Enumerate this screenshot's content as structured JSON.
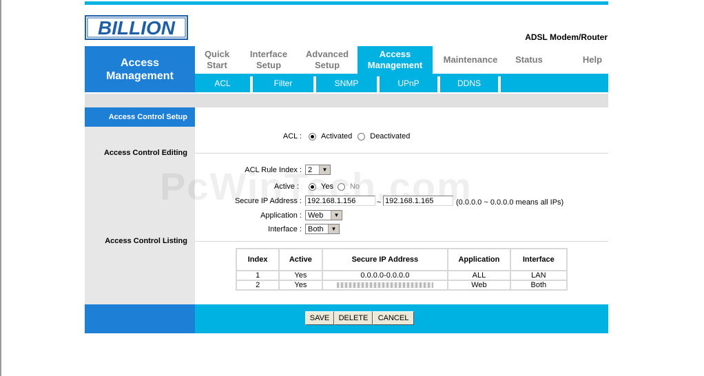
{
  "brand": {
    "logo": "BILLION",
    "product": "ADSL Modem/Router",
    "accent": "#00b2e2",
    "sidebar_color": "#1e7fd6"
  },
  "page_title": "Access Management",
  "main_nav": [
    {
      "label": "Quick Start"
    },
    {
      "label": "Interface Setup"
    },
    {
      "label": "Advanced Setup"
    },
    {
      "label": "Access Management",
      "active": true
    },
    {
      "label": "Maintenance"
    },
    {
      "label": "Status"
    },
    {
      "label": "Help"
    }
  ],
  "sub_nav": [
    {
      "label": "ACL"
    },
    {
      "label": "Filter"
    },
    {
      "label": "SNMP"
    },
    {
      "label": "UPnP"
    },
    {
      "label": "DDNS"
    }
  ],
  "side": {
    "active": "Access Control Setup",
    "editing": "Access Control Editing",
    "listing": "Access Control Listing"
  },
  "form": {
    "acl_label": "ACL :",
    "acl_options": [
      "Activated",
      "Deactivated"
    ],
    "acl_selected": "Activated",
    "rule_index_label": "ACL Rule Index :",
    "rule_index_value": "2",
    "active_label": "Active :",
    "active_options": [
      "Yes",
      "No"
    ],
    "active_selected": "Yes",
    "secure_ip_label": "Secure IP Address :",
    "ip_start": "192.168.1.156",
    "ip_sep": "~",
    "ip_end": "192.168.1.165",
    "ip_hint": "(0.0.0.0 ~ 0.0.0.0 means all IPs)",
    "application_label": "Application :",
    "application_value": "Web",
    "interface_label": "Interface :",
    "interface_value": "Both"
  },
  "table": {
    "headers": [
      "Index",
      "Active",
      "Secure IP Address",
      "Application",
      "Interface"
    ],
    "rows": [
      [
        "1",
        "Yes",
        "0.0.0.0-0.0.0.0",
        "ALL",
        "LAN"
      ],
      [
        "2",
        "Yes",
        "",
        "Web",
        "Both"
      ]
    ]
  },
  "buttons": {
    "save": "SAVE",
    "delete": "DELETE",
    "cancel": "CANCEL"
  },
  "watermark": "PcWinTech.com"
}
